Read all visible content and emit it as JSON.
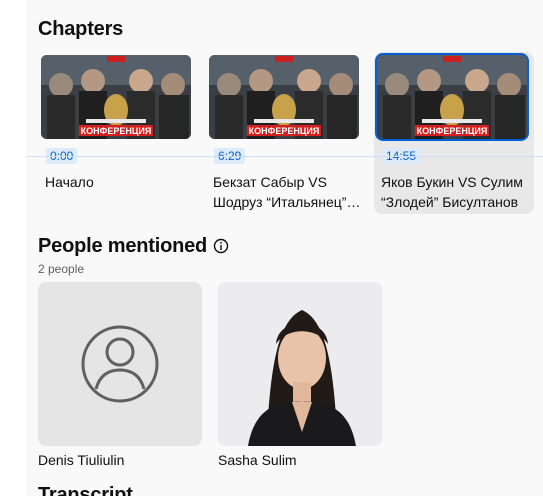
{
  "chapters": {
    "title": "Chapters",
    "items": [
      {
        "time": "0:00",
        "title": "Начало",
        "thumb_caption": "КОНФЕРЕНЦИЯ",
        "active": false
      },
      {
        "time": "6:29",
        "title": "Бекзат Сабыр VS Шодруз “Итальянец” Хайитов",
        "thumb_caption": "КОНФЕРЕНЦИЯ",
        "active": false
      },
      {
        "time": "14:55",
        "title": "Яков Букин VS Сулим “Злодей” Бисултанов",
        "thumb_caption": "КОНФЕРЕНЦИЯ",
        "active": true
      }
    ]
  },
  "people": {
    "title": "People mentioned",
    "count": "2 people",
    "items": [
      {
        "name": "Denis Tiuliulin",
        "image": "default-avatar-icon"
      },
      {
        "name": "Sasha Sulim",
        "image": "person-photo"
      }
    ]
  },
  "transcript": {
    "title": "Transcript"
  },
  "colors": {
    "accent": "#065fd4",
    "thumb_banner": "#d41f1f",
    "panel_bg": "#f9f9f9"
  }
}
